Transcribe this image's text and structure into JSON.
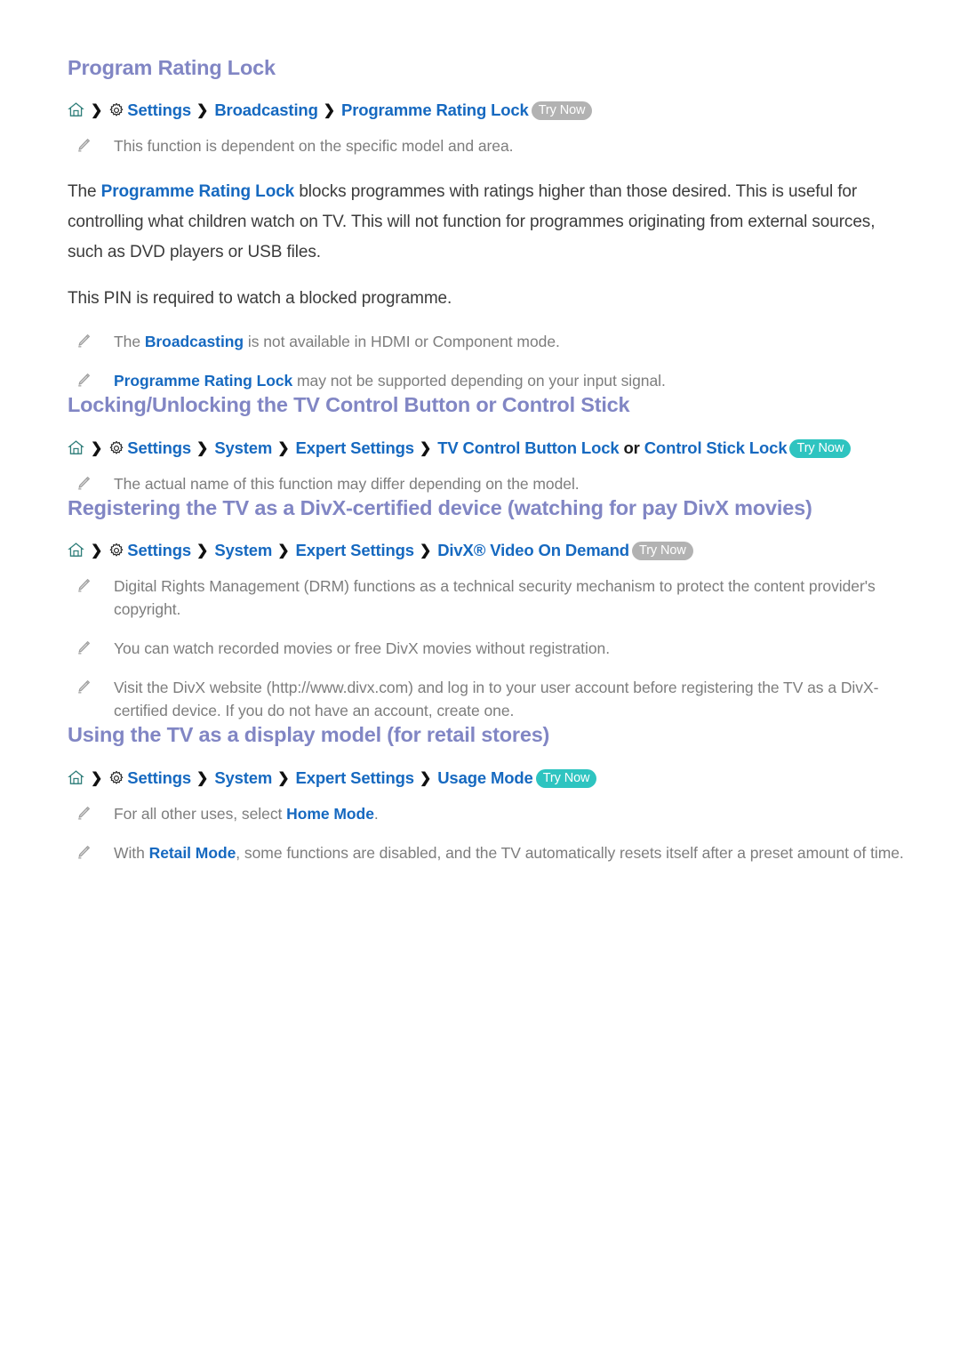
{
  "document": {
    "type": "tv-e-manual-page",
    "background": "#ffffff",
    "heading_color": "#8186c4",
    "link_color": "#1669c0",
    "note_color": "#7d7d7d",
    "body_color": "#3b3b3b",
    "trynow_gray": "#b2b2b2",
    "trynow_teal": "#2ec4c0"
  },
  "sections": [
    {
      "id": "program-rating-lock",
      "title": "Program Rating Lock",
      "breadcrumb": {
        "home_icon": "home-icon",
        "gear_icon": "gear-icon",
        "separator": "❯",
        "items": [
          {
            "label": "Settings",
            "style": "link"
          },
          {
            "label": "Broadcasting",
            "style": "link"
          },
          {
            "label": "Programme Rating Lock",
            "style": "link"
          }
        ],
        "try_now": {
          "label": "Try Now",
          "color": "gray"
        }
      },
      "notes_top": [
        {
          "text": "This function is dependent on the specific model and area."
        }
      ],
      "paragraphs": [
        {
          "parts": [
            {
              "t": "The ",
              "style": "plain"
            },
            {
              "t": "Programme Rating Lock",
              "style": "blue"
            },
            {
              "t": " blocks programmes with ratings higher than those desired. This is useful for controlling what children watch on TV. This will not function for programmes originating from external sources, such as DVD players or USB files.",
              "style": "plain"
            }
          ]
        },
        {
          "parts": [
            {
              "t": "This PIN is required to watch a blocked programme.",
              "style": "plain"
            }
          ]
        }
      ],
      "notes_bottom": [
        {
          "parts": [
            {
              "t": "The ",
              "style": "plain"
            },
            {
              "t": "Broadcasting",
              "style": "blue"
            },
            {
              "t": " is not available in HDMI or Component mode.",
              "style": "plain"
            }
          ]
        },
        {
          "parts": [
            {
              "t": "Programme Rating Lock",
              "style": "blue"
            },
            {
              "t": " may not be supported depending on your input signal.",
              "style": "plain"
            }
          ]
        }
      ]
    },
    {
      "id": "locking-unlocking-tv-control-button",
      "title": "Locking/Unlocking the TV Control Button or Control Stick",
      "breadcrumb": {
        "items": [
          {
            "label": "Settings",
            "style": "link"
          },
          {
            "label": "System",
            "style": "link"
          },
          {
            "label": "Expert Settings",
            "style": "link"
          },
          {
            "label": "TV Control Button Lock",
            "style": "link"
          },
          {
            "label": "or",
            "style": "plain-inline"
          },
          {
            "label": "Control Stick Lock",
            "style": "link"
          }
        ],
        "try_now": {
          "label": "Try Now",
          "color": "teal"
        }
      },
      "notes_bottom": [
        {
          "parts": [
            {
              "t": "The actual name of this function may differ depending on the model.",
              "style": "plain"
            }
          ]
        }
      ]
    },
    {
      "id": "registering-divx",
      "title": "Registering the TV as a DivX-certified device (watching for pay DivX movies)",
      "breadcrumb": {
        "items": [
          {
            "label": "Settings",
            "style": "link"
          },
          {
            "label": "System",
            "style": "link"
          },
          {
            "label": "Expert Settings",
            "style": "link"
          },
          {
            "label": "DivX® Video On Demand",
            "style": "link"
          }
        ],
        "try_now": {
          "label": "Try Now",
          "color": "gray"
        }
      },
      "notes_bottom": [
        {
          "parts": [
            {
              "t": "Digital Rights Management (DRM) functions as a technical security mechanism to protect the content provider's copyright.",
              "style": "plain"
            }
          ]
        },
        {
          "parts": [
            {
              "t": "You can watch recorded movies or free DivX movies without registration.",
              "style": "plain"
            }
          ]
        },
        {
          "parts": [
            {
              "t": "Visit the DivX website (http://www.divx.com) and log in to your user account before registering the TV as a DivX-certified device. If you do not have an account, create one.",
              "style": "plain"
            }
          ]
        }
      ]
    },
    {
      "id": "using-tv-as-display-model",
      "title": "Using the TV as a display model (for retail stores)",
      "breadcrumb": {
        "items": [
          {
            "label": "Settings",
            "style": "link"
          },
          {
            "label": "System",
            "style": "link"
          },
          {
            "label": "Expert Settings",
            "style": "link"
          },
          {
            "label": "Usage Mode",
            "style": "link"
          }
        ],
        "try_now": {
          "label": "Try Now",
          "color": "teal"
        }
      },
      "notes_bottom": [
        {
          "parts": [
            {
              "t": "For all other uses, select ",
              "style": "plain"
            },
            {
              "t": "Home Mode",
              "style": "blue"
            },
            {
              "t": ".",
              "style": "plain"
            }
          ]
        },
        {
          "parts": [
            {
              "t": "With ",
              "style": "plain"
            },
            {
              "t": "Retail Mode",
              "style": "blue"
            },
            {
              "t": ", some functions are disabled, and the TV automatically resets itself after a preset amount of time.",
              "style": "plain"
            }
          ]
        }
      ]
    }
  ]
}
